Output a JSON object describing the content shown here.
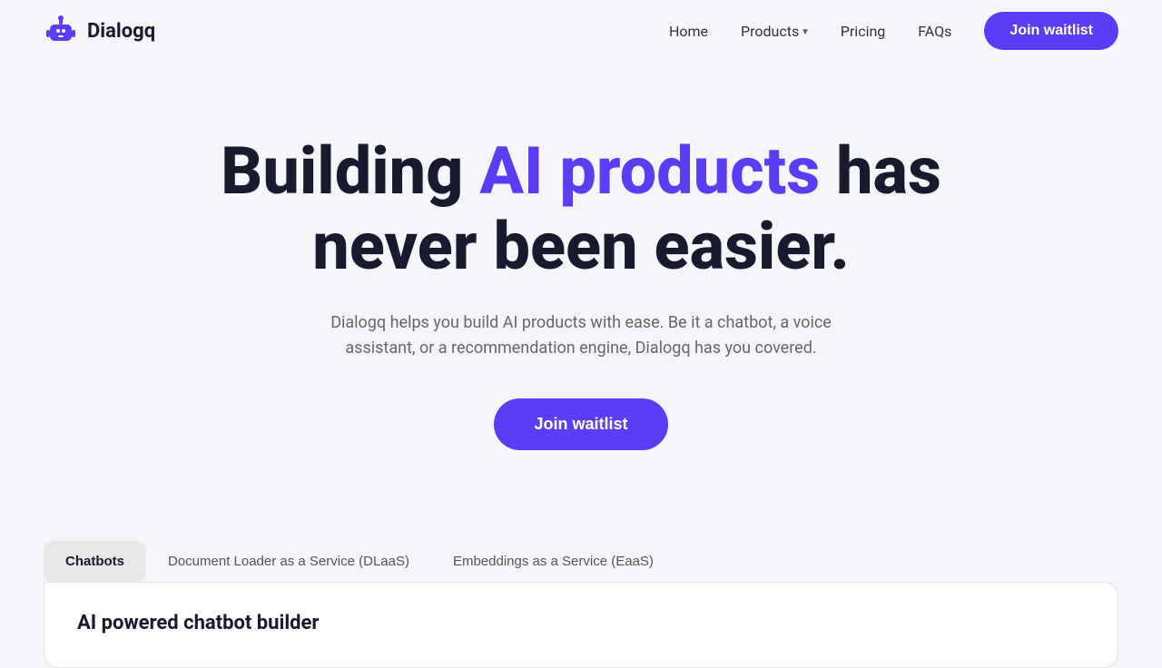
{
  "brand": {
    "name": "Dialogq",
    "logo_alt": "Dialogq logo"
  },
  "nav": {
    "links": [
      {
        "label": "Home",
        "id": "home",
        "has_dropdown": false
      },
      {
        "label": "Products",
        "id": "products",
        "has_dropdown": true
      },
      {
        "label": "Pricing",
        "id": "pricing",
        "has_dropdown": false
      },
      {
        "label": "FAQs",
        "id": "faqs",
        "has_dropdown": false
      }
    ],
    "cta_label": "Join waitlist"
  },
  "hero": {
    "title_prefix": "Building ",
    "title_accent": "AI products",
    "title_suffix": " has never been easier.",
    "subtitle": "Dialogq helps you build AI products with ease. Be it a chatbot, a voice assistant, or a recommendation engine, Dialogq has you covered.",
    "cta_label": "Join waitlist"
  },
  "tabs": [
    {
      "label": "Chatbots",
      "id": "chatbots",
      "active": true
    },
    {
      "label": "Document Loader as a Service (DLaaS)",
      "id": "dlaas",
      "active": false
    },
    {
      "label": "Embeddings as a Service (EaaS)",
      "id": "eaas",
      "active": false
    }
  ],
  "panel": {
    "title": "AI powered chatbot builder"
  },
  "colors": {
    "accent": "#5b3df5",
    "text_dark": "#1a1a2e",
    "text_muted": "#666"
  }
}
